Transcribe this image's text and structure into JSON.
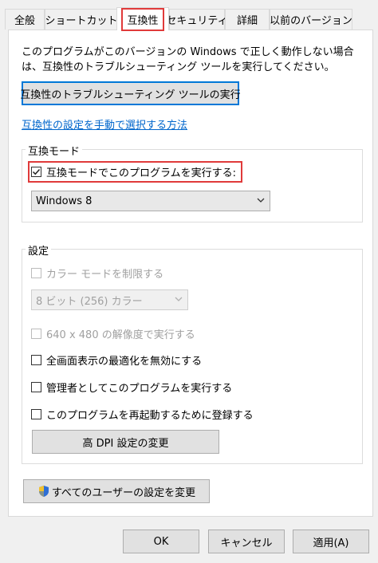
{
  "tabs": [
    {
      "label": "全般"
    },
    {
      "label": "ショートカット"
    },
    {
      "label": "互換性"
    },
    {
      "label": "セキュリティ"
    },
    {
      "label": "詳細"
    },
    {
      "label": "以前のバージョン"
    }
  ],
  "description": "このプログラムがこのバージョンの Windows で正しく動作しない場合は、互換性のトラブルシューティング ツールを実行してください。",
  "troubleshoot_button": "互換性のトラブルシューティング ツールの実行",
  "manual_link": "互換性の設定を手動で選択する方法",
  "compat_mode": {
    "title": "互換モード",
    "checkbox_label": "互換モードでこのプログラムを実行する:",
    "checked": true,
    "os_select_value": "Windows 8"
  },
  "settings": {
    "title": "設定",
    "color_mode_label": "カラー モードを制限する",
    "color_select_value": "8 ビット (256) カラー",
    "resolution_label": "640 x 480 の解像度で実行する",
    "fullscreen_label": "全画面表示の最適化を無効にする",
    "admin_label": "管理者としてこのプログラムを実行する",
    "restart_label": "このプログラムを再起動するために登録する",
    "dpi_button": "高 DPI 設定の変更"
  },
  "all_users_button": "すべてのユーザーの設定を変更",
  "footer": {
    "ok": "OK",
    "cancel": "キャンセル",
    "apply": "適用(A)"
  },
  "colors": {
    "highlight": "#e03a3a",
    "link": "#0066cc",
    "focus_border": "#0078d7"
  },
  "icons": {
    "checkmark": "checkmark-icon",
    "dropdown": "chevron-down-icon",
    "shield": "uac-shield-icon"
  }
}
